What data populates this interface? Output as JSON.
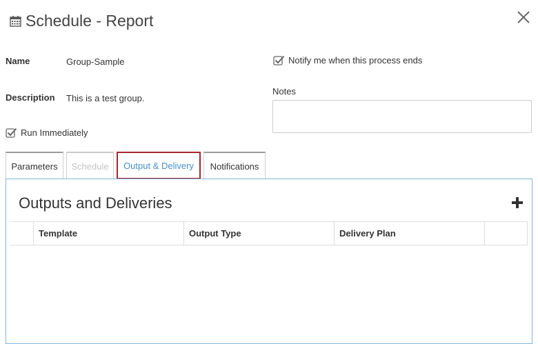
{
  "header": {
    "title": "Schedule - Report",
    "title_icon": "calendar-icon",
    "close_icon": "close-icon"
  },
  "form": {
    "name_label": "Name",
    "name_value": "Group-Sample",
    "description_label": "Description",
    "description_value": "This is a test group.",
    "run_immediately_label": "Run Immediately",
    "run_immediately_checked": true,
    "notify_label": "Notify me when this process ends",
    "notify_checked": true,
    "notes_label": "Notes",
    "notes_value": ""
  },
  "tabs": [
    {
      "label": "Parameters",
      "state": "normal"
    },
    {
      "label": "Schedule",
      "state": "disabled"
    },
    {
      "label": "Output & Delivery",
      "state": "active"
    },
    {
      "label": "Notifications",
      "state": "normal"
    }
  ],
  "outputs": {
    "title": "Outputs and Deliveries",
    "add_icon": "plus-icon",
    "columns": [
      "Template",
      "Output Type",
      "Delivery Plan"
    ],
    "rows": []
  },
  "colors": {
    "accent": "#4a90c8",
    "active_tab_border": "#a4262c",
    "panel_border": "#7fb5dc"
  }
}
